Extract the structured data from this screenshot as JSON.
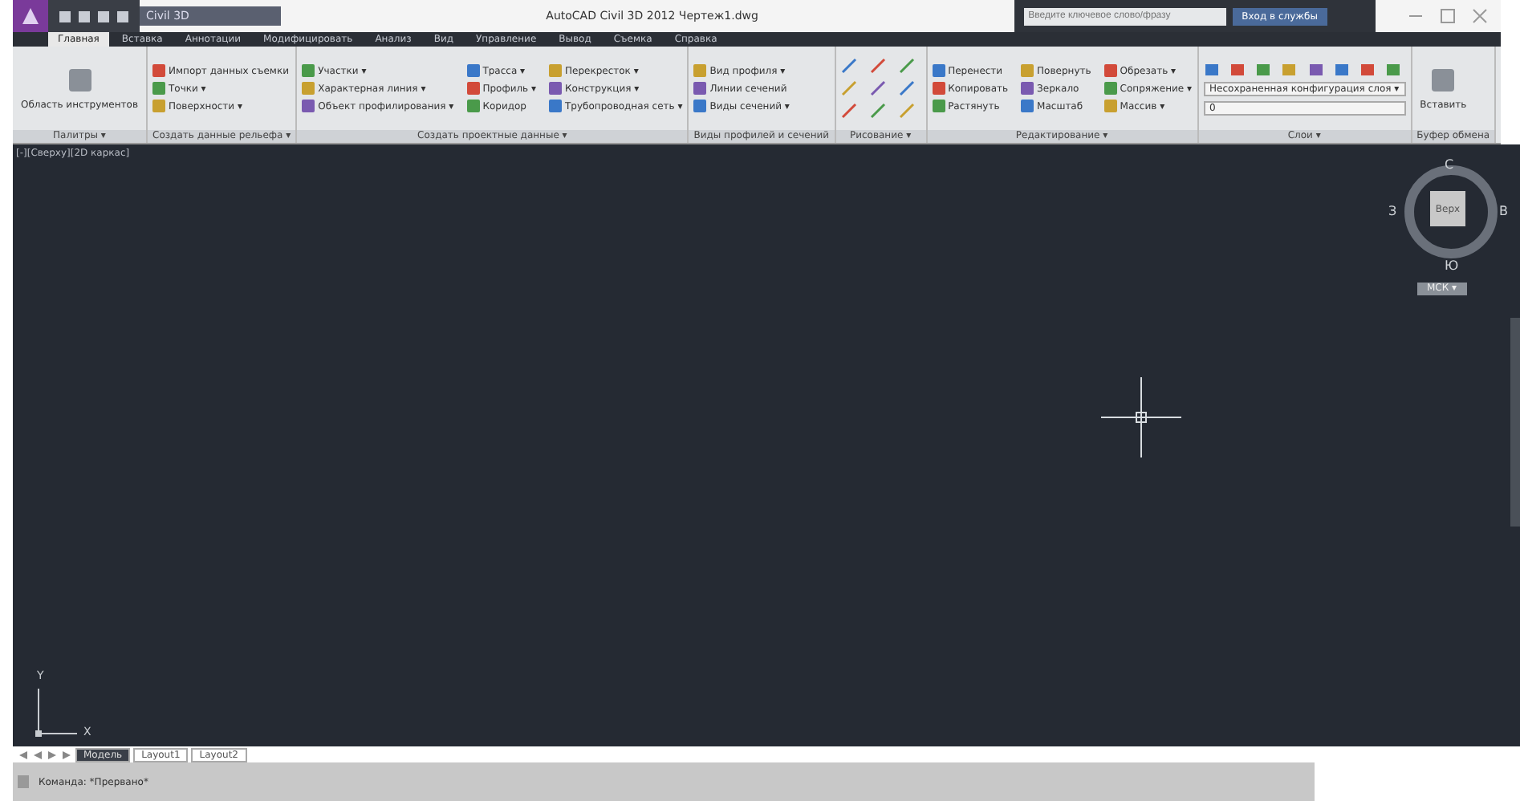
{
  "title_bar": {
    "workspace": "Civil 3D",
    "title": "AutoCAD Civil 3D 2012   Чертеж1.dwg",
    "search": {
      "placeholder": "Введите ключевое слово/фразу"
    },
    "sign_in": "Вход в службы"
  },
  "tabs": [
    {
      "label": "Главная",
      "selected": true
    },
    {
      "label": "Вставка",
      "selected": false
    },
    {
      "label": "Аннотации",
      "selected": false
    },
    {
      "label": "Модифицировать",
      "selected": false
    },
    {
      "label": "Анализ",
      "selected": false
    },
    {
      "label": "Вид",
      "selected": false
    },
    {
      "label": "Управление",
      "selected": false
    },
    {
      "label": "Вывод",
      "selected": false
    },
    {
      "label": "Съемка",
      "selected": false
    },
    {
      "label": "Справка",
      "selected": false
    }
  ],
  "panels": [
    {
      "title": "Палитры ▾",
      "kind": "large",
      "items": [
        "Область инструментов"
      ]
    },
    {
      "title": "Создать данные рельефа ▾",
      "kind": "list",
      "items": [
        "Импорт данных съемки",
        "Точки ▾",
        "Поверхности ▾"
      ]
    },
    {
      "title": "Создать проектные данные ▾",
      "kind": "list",
      "items": [
        "Участки ▾",
        "Характерная линия ▾",
        "Объект профилирования ▾",
        "Трасса ▾",
        "Профиль ▾",
        "Коридор",
        "Перекресток ▾",
        "Конструкция ▾",
        "Трубопроводная сеть ▾"
      ]
    },
    {
      "title": "Виды профилей и сечений",
      "kind": "list",
      "items": [
        "Вид профиля ▾",
        "Линии сечений",
        "Виды сечений ▾"
      ]
    },
    {
      "title": "Рисование ▾",
      "kind": "icons"
    },
    {
      "title": "Редактирование ▾",
      "kind": "list",
      "items": [
        "Перенести",
        "Копировать",
        "Растянуть",
        "Повернуть",
        "Зеркало",
        "Масштаб",
        "Обрезать ▾",
        "Сопряжение ▾",
        "Массив ▾"
      ]
    },
    {
      "title": "Слои ▾",
      "kind": "layers",
      "items": [
        "Несохраненная конфигурация слоя ▾",
        "0"
      ]
    },
    {
      "title": "Буфер обмена",
      "kind": "large",
      "items": [
        "Вставить"
      ]
    }
  ],
  "viewport": {
    "label": "[-][Сверху][2D каркас]",
    "viewcube": {
      "north": "С",
      "east": "В",
      "south": "Ю",
      "west": "З",
      "face": "Верх",
      "ucs": "МСК ▾"
    },
    "ucs_x": "X",
    "ucs_y": "Y"
  },
  "layout_tabs": [
    {
      "label": "Модель",
      "selected": true
    },
    {
      "label": "Layout1",
      "selected": false
    },
    {
      "label": "Layout2",
      "selected": false
    }
  ],
  "command_line": "Команда: *Прервано*"
}
